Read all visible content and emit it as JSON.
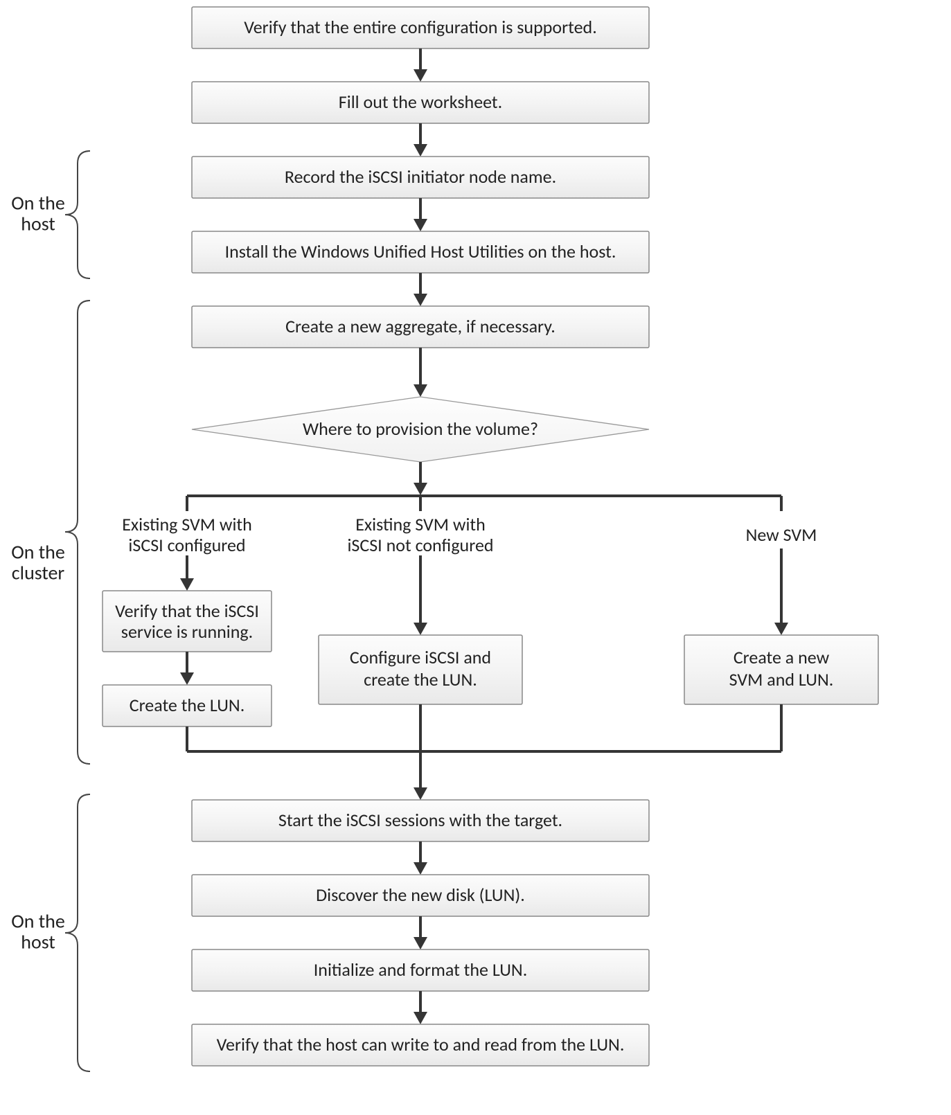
{
  "labels": {
    "host1": {
      "l1": "On the",
      "l2": "host"
    },
    "cluster": {
      "l1": "On the",
      "l2": "cluster"
    },
    "host2": {
      "l1": "On the",
      "l2": "host"
    }
  },
  "steps": {
    "verify_config": "Verify that the entire configuration is supported.",
    "worksheet": "Fill out the worksheet.",
    "record_iqn": "Record the iSCSI initiator node name.",
    "install_whu": "Install the Windows Unified Host Utilities on the host.",
    "aggregate": "Create a new aggregate, if necessary.",
    "decision": "Where to provision the volume?",
    "branch1_label": {
      "l1": "Existing SVM with",
      "l2": "iSCSI configured"
    },
    "branch2_label": {
      "l1": "Existing SVM with",
      "l2": "iSCSI not configured"
    },
    "branch3_label": "New SVM",
    "b1_verify": {
      "l1": "Verify that the iSCSI",
      "l2": "service is running."
    },
    "b1_create": "Create the LUN.",
    "b2_step": {
      "l1": "Configure iSCSI and",
      "l2": "create the LUN."
    },
    "b3_step": {
      "l1": "Create a new",
      "l2": "SVM and LUN."
    },
    "start_sessions": "Start the iSCSI sessions with the target.",
    "discover": "Discover the new disk (LUN).",
    "init_format": "Initialize and format the LUN.",
    "verify_rw": "Verify that the host can write to and read from the LUN."
  }
}
